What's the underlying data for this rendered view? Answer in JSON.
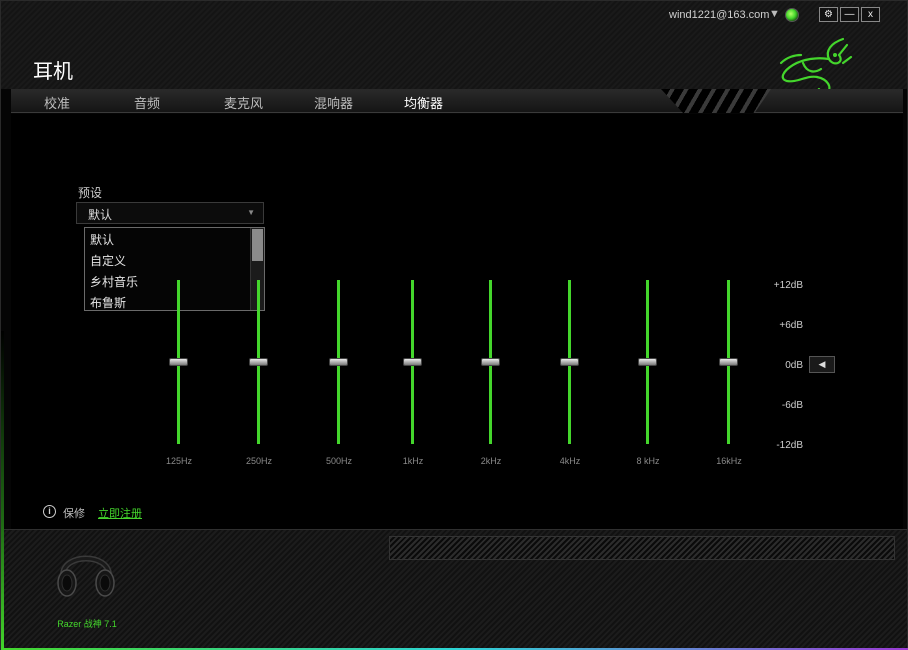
{
  "app": {
    "title": "耳机"
  },
  "account": {
    "email": "wind1221@163.com",
    "caret": "▼"
  },
  "window_controls": {
    "settings": "⚙",
    "minimize": "—",
    "close": "x"
  },
  "tabs": [
    {
      "label": "校准",
      "active": false
    },
    {
      "label": "音频",
      "active": false
    },
    {
      "label": "麦克风",
      "active": false
    },
    {
      "label": "混响器",
      "active": false
    },
    {
      "label": "均衡器",
      "active": true
    }
  ],
  "preset": {
    "label": "预设",
    "selected": "默认",
    "options": [
      "默认",
      "自定义",
      "乡村音乐",
      "布鲁斯"
    ]
  },
  "equalizer": {
    "bands": [
      {
        "freq": "125Hz",
        "gain_db": 0
      },
      {
        "freq": "250Hz",
        "gain_db": 0
      },
      {
        "freq": "500Hz",
        "gain_db": 0
      },
      {
        "freq": "1kHz",
        "gain_db": 0
      },
      {
        "freq": "2kHz",
        "gain_db": 0
      },
      {
        "freq": "4kHz",
        "gain_db": 0
      },
      {
        "freq": "8 kHz",
        "gain_db": 0
      },
      {
        "freq": "16kHz",
        "gain_db": 0
      }
    ],
    "scale": [
      "+12dB",
      "+6dB",
      "0dB",
      "-6dB",
      "-12dB"
    ],
    "range_db": [
      -12,
      12
    ],
    "reset_icon": "◀"
  },
  "warranty": {
    "icon": "i",
    "label": "保修",
    "register_link": "立即注册"
  },
  "device": {
    "name": "Razer 战神 7.1"
  },
  "colors": {
    "accent": "#44d62c",
    "background": "#000000"
  }
}
